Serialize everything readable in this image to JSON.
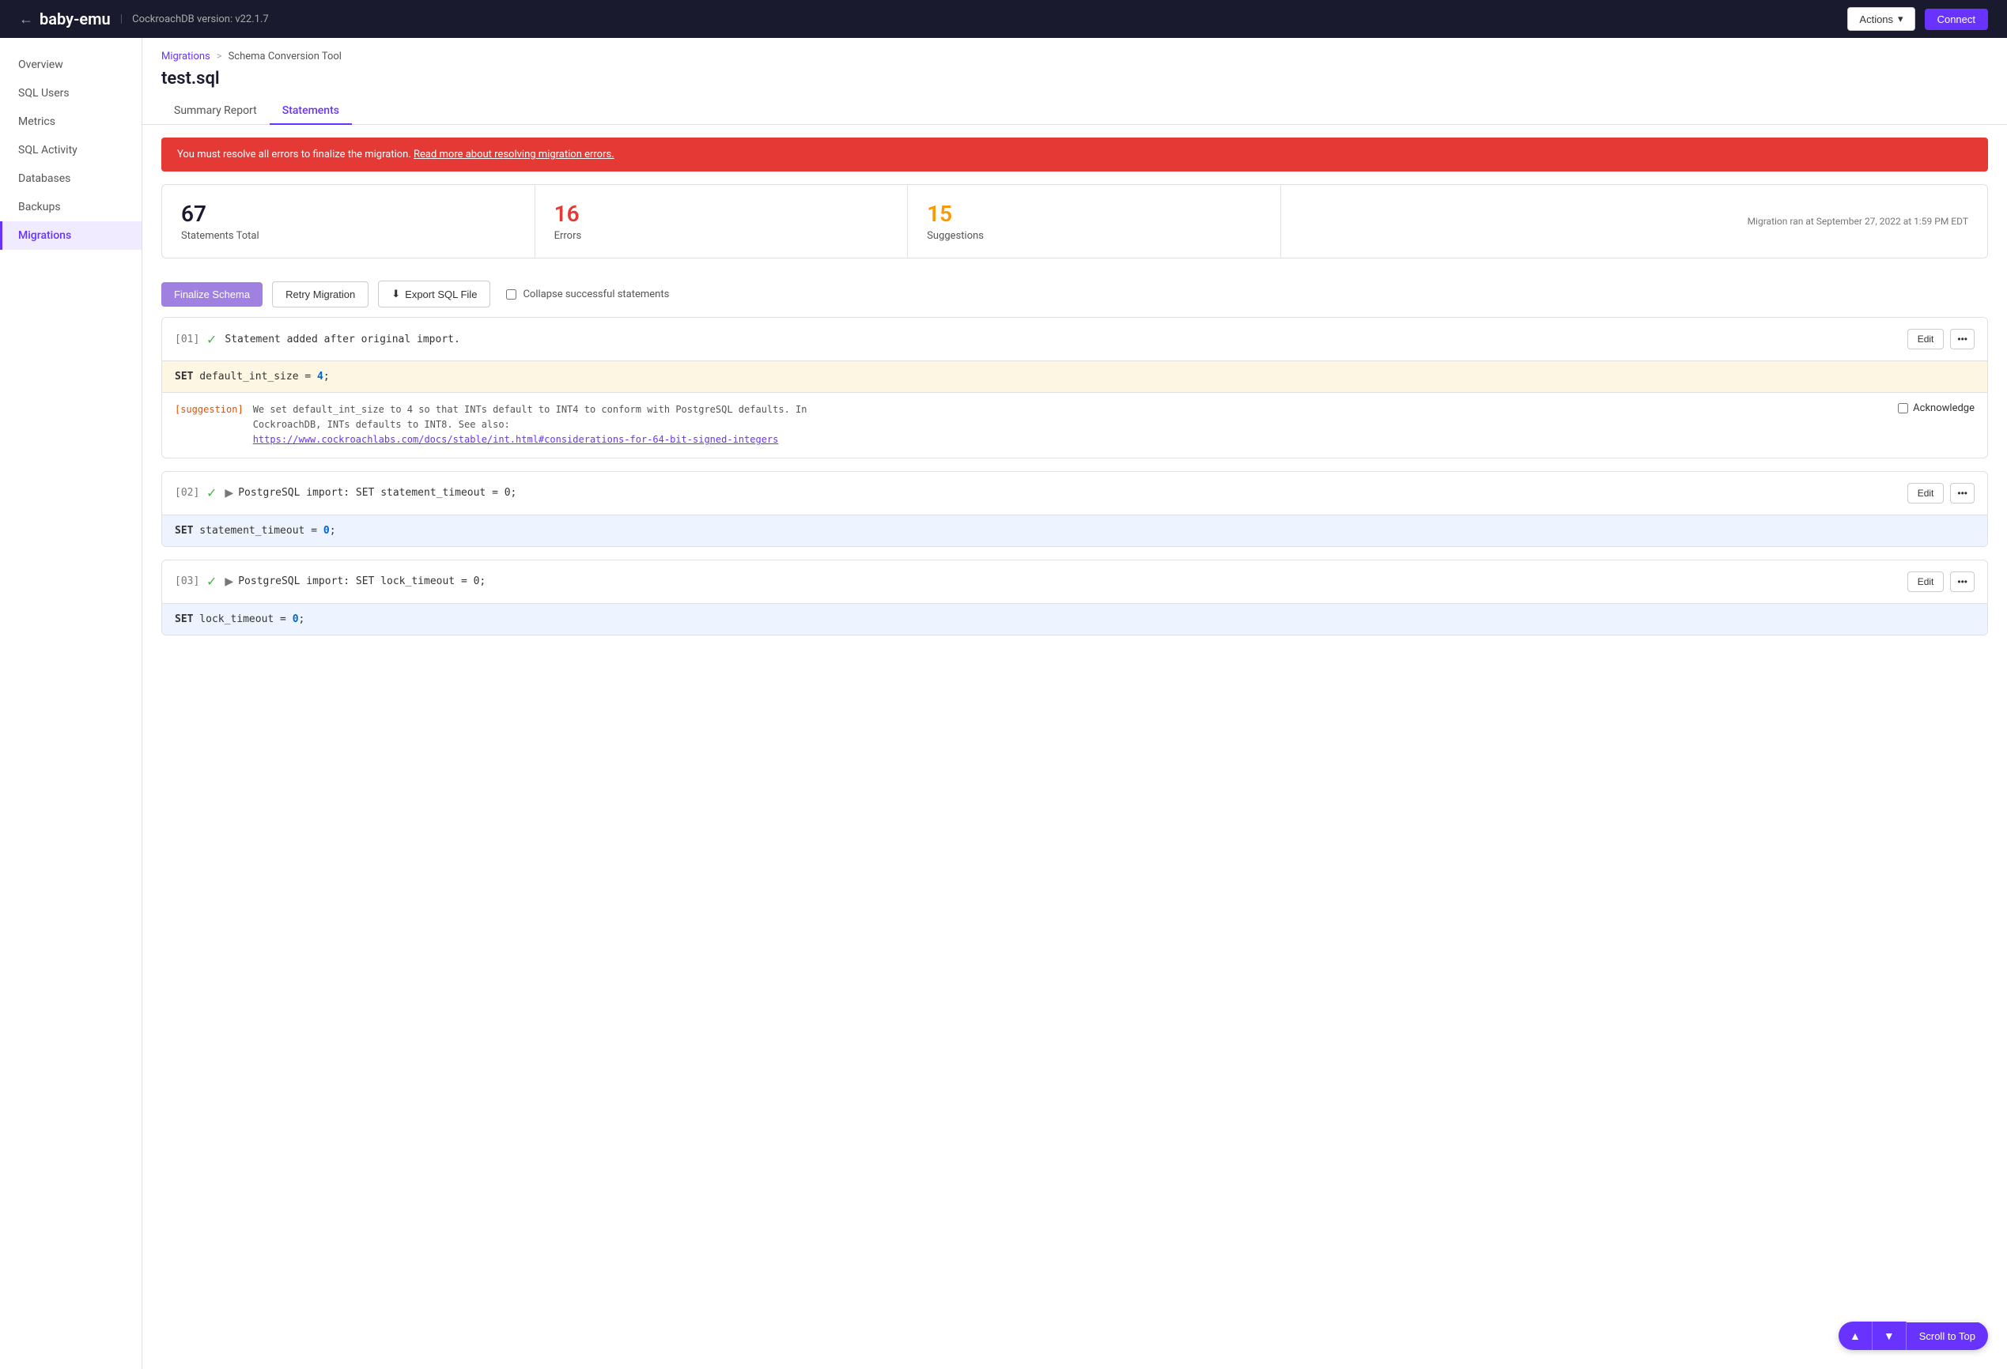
{
  "topbar": {
    "back_icon": "←",
    "title": "baby-emu",
    "divider": "|",
    "version_label": "CockroachDB version:  v22.1.7",
    "actions_label": "Actions",
    "actions_chevron": "▾",
    "connect_label": "Connect"
  },
  "sidebar": {
    "items": [
      {
        "id": "overview",
        "label": "Overview",
        "active": false
      },
      {
        "id": "sql-users",
        "label": "SQL Users",
        "active": false
      },
      {
        "id": "metrics",
        "label": "Metrics",
        "active": false
      },
      {
        "id": "sql-activity",
        "label": "SQL Activity",
        "active": false
      },
      {
        "id": "databases",
        "label": "Databases",
        "active": false
      },
      {
        "id": "backups",
        "label": "Backups",
        "active": false
      },
      {
        "id": "migrations",
        "label": "Migrations",
        "active": true
      }
    ]
  },
  "breadcrumb": {
    "migrations_link": "Migrations",
    "separator": ">",
    "current": "Schema Conversion Tool"
  },
  "page": {
    "title": "test.sql",
    "tabs": [
      {
        "id": "summary",
        "label": "Summary Report",
        "active": false
      },
      {
        "id": "statements",
        "label": "Statements",
        "active": true
      }
    ]
  },
  "alert": {
    "text": "You must resolve all errors to finalize the migration. ",
    "link_text": "Read more about resolving migration errors."
  },
  "stats": {
    "total": {
      "value": "67",
      "label": "Statements Total"
    },
    "errors": {
      "value": "16",
      "label": "Errors"
    },
    "suggestions": {
      "value": "15",
      "label": "Suggestions"
    },
    "timestamp": "Migration ran at September 27, 2022 at 1:59 PM EDT"
  },
  "toolbar": {
    "finalize_label": "Finalize Schema",
    "retry_label": "Retry Migration",
    "export_icon": "⬇",
    "export_label": "Export SQL File",
    "collapse_label": "Collapse successful statements"
  },
  "statements": [
    {
      "num": "[01]",
      "status": "success",
      "text": "Statement added after original import.",
      "code": "SET default_int_size = 4;",
      "code_bg": "warm",
      "has_suggestion": true,
      "suggestion_tag": "[suggestion]",
      "suggestion_text": "We set default_int_size to 4 so that INTs default to INT4 to conform with PostgreSQL defaults. In\nCockroachDB, INTs defaults to INT8. See also:",
      "suggestion_link": "https://www.cockroachlabs.com/docs/stable/int.html#considerations-for-64-bit-signed-integers",
      "has_arrow": false
    },
    {
      "num": "[02]",
      "status": "success",
      "text": "PostgreSQL import: SET statement_timeout = 0;",
      "code": "SET statement_timeout = 0;",
      "code_bg": "blue",
      "has_suggestion": false,
      "has_arrow": true
    },
    {
      "num": "[03]",
      "status": "success",
      "text": "PostgreSQL import: SET lock_timeout = 0;",
      "code": "SET lock_timeout = 0;",
      "code_bg": "blue",
      "has_suggestion": false,
      "has_arrow": true
    }
  ],
  "scroll": {
    "up_icon": "▲",
    "down_icon": "▼",
    "label": "Scroll to Top"
  }
}
